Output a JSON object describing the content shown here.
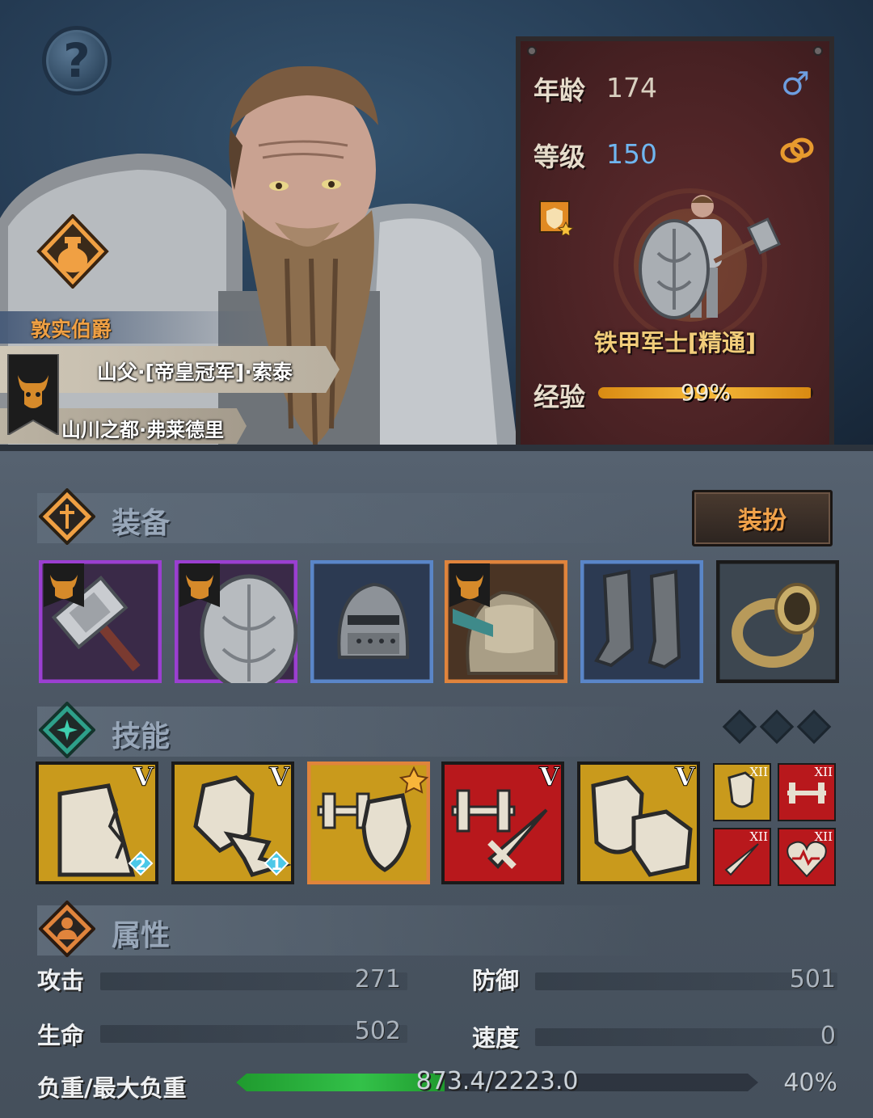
{
  "header": {
    "title_text": "敦实伯爵",
    "name_text": "山父·[帝皇冠军]·索泰",
    "home_text": "山川之都·弗莱德里"
  },
  "info": {
    "age_label": "年龄",
    "age_value": "174",
    "level_label": "等级",
    "level_value": "150",
    "class_name": "铁甲军士[精通]",
    "exp_label": "经验",
    "exp_percent_text": "99%",
    "exp_fraction": 0.99,
    "gender_icon": "male-symbol-icon"
  },
  "equipment": {
    "title": "装备",
    "dress_label": "装扮",
    "slots": [
      {
        "item": "warhammer",
        "rarity": "purple",
        "border": "#9b3fd1",
        "faction_flag": true
      },
      {
        "item": "shield",
        "rarity": "purple",
        "border": "#9b3fd1",
        "faction_flag": true
      },
      {
        "item": "helmet",
        "rarity": "blue",
        "border": "#5a86c8",
        "faction_flag": false
      },
      {
        "item": "armor",
        "rarity": "orange",
        "border": "#e0843c",
        "faction_flag": true
      },
      {
        "item": "boots",
        "rarity": "blue",
        "border": "#5a86c8",
        "faction_flag": false
      },
      {
        "item": "ring",
        "rarity": "none",
        "border": "#1a1a1a",
        "faction_flag": false
      }
    ]
  },
  "skills": {
    "title": "技能",
    "large": [
      {
        "name": "shield-wall-skill",
        "tier": "V",
        "badge": "2",
        "color": "gold"
      },
      {
        "name": "shield-push-skill",
        "tier": "V",
        "badge": "1",
        "color": "gold"
      },
      {
        "name": "weight-shield-skill",
        "tier": "",
        "badge": "",
        "color": "gold",
        "star": true
      },
      {
        "name": "weight-sword-skill",
        "tier": "V",
        "badge": "",
        "color": "red"
      },
      {
        "name": "shield-gauntlet-skill",
        "tier": "V",
        "badge": "",
        "color": "gold"
      }
    ],
    "small": [
      {
        "name": "shield-mastery-skill",
        "tier": "XII",
        "color": "gold"
      },
      {
        "name": "strength-mastery-skill",
        "tier": "XII",
        "color": "red"
      },
      {
        "name": "sword-mastery-skill",
        "tier": "XII",
        "color": "red"
      },
      {
        "name": "vitality-mastery-skill",
        "tier": "XII",
        "color": "red"
      }
    ]
  },
  "attributes": {
    "title": "属性",
    "attack_label": "攻击",
    "attack_value": "271",
    "defense_label": "防御",
    "defense_value": "501",
    "health_label": "生命",
    "health_value": "502",
    "speed_label": "速度",
    "speed_value": "0",
    "load_label": "负重/最大负重",
    "load_text": "873.4/2223.0",
    "load_percent_text": "40%",
    "load_fraction": 0.4
  },
  "colors": {
    "accent_orange": "#f0a043",
    "level_blue": "#6fb6f0",
    "load_green": "#33c149",
    "exp_gold": "#f5b93a"
  }
}
